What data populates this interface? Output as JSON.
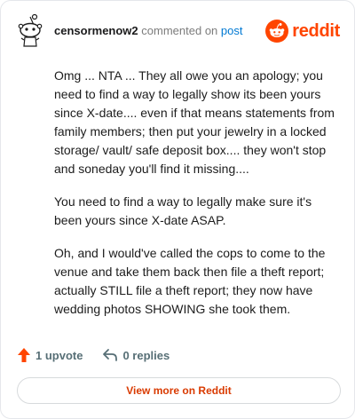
{
  "header": {
    "username": "censormenow2",
    "action_text": "commented on",
    "post_link": "post",
    "brand_word": "reddit"
  },
  "comment": {
    "paragraphs": [
      "Omg ... NTA ... They all owe you an apology; you need to find a way to legally show its been yours since X-date.... even if that means statements from family members; then put your jewelry in a locked storage/ vault/ safe deposit box.... they won't stop and soneday you'll find it missing....",
      "You need to find a way to legally make sure it's been yours since X-date ASAP.",
      "Oh, and I would've called the cops to come to the venue and take them back then file a theft report; actually STILL file a theft report; they now have wedding photos SHOWING she took them."
    ]
  },
  "actions": {
    "upvote_label": "1 upvote",
    "replies_label": "0 replies"
  },
  "footer": {
    "view_more_label": "View more on Reddit"
  },
  "colors": {
    "brand": "#ff4500",
    "upvote": "#ff4500",
    "link": "#0079d3",
    "view_more_text": "#d93a00"
  },
  "icons": {
    "avatar": "snoo-avatar-icon",
    "brand": "reddit-logo-icon",
    "upvote": "upvote-arrow-icon",
    "reply": "reply-arrow-icon"
  }
}
